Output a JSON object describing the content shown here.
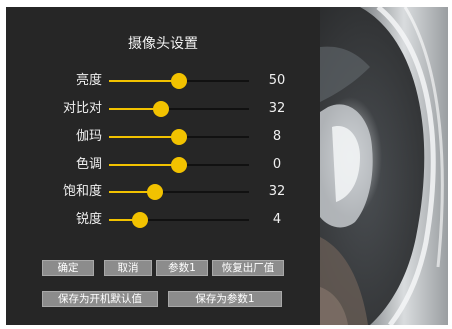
{
  "title": "摄像头设置",
  "sliders": [
    {
      "label": "亮度",
      "value": "50",
      "level": 0.5
    },
    {
      "label": "对比对",
      "value": "32",
      "level": 0.37
    },
    {
      "label": "伽玛",
      "value": "8",
      "level": 0.5
    },
    {
      "label": "色调",
      "value": "0",
      "level": 0.5
    },
    {
      "label": "饱和度",
      "value": "32",
      "level": 0.33
    },
    {
      "label": "锐度",
      "value": "4",
      "level": 0.22
    }
  ],
  "buttons": {
    "confirm": "确定",
    "cancel": "取消",
    "param1": "参数1",
    "restore": "恢复出厂值",
    "save_default": "保存为开机默认值",
    "save_param1": "保存为参数1"
  },
  "colors": {
    "accent": "#f2c200",
    "panel": "#262626",
    "button": "#8c8c8c"
  }
}
